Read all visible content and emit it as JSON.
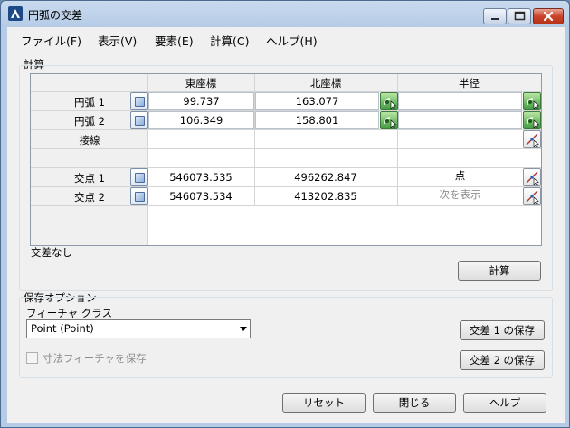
{
  "window": {
    "title": "円弧の交差"
  },
  "menu": [
    "ファイル(F)",
    "表示(V)",
    "要素(E)",
    "計算(C)",
    "ヘルプ(H)"
  ],
  "calc_group": {
    "label": "計算",
    "columns": [
      "東座標",
      "北座標",
      "半径"
    ],
    "rows": {
      "arc1": {
        "label": "円弧 1",
        "east": "99.737",
        "north": "163.077",
        "radius": ""
      },
      "arc2": {
        "label": "円弧 2",
        "east": "106.349",
        "north": "158.801",
        "radius": ""
      },
      "tangent": {
        "label": "接線"
      },
      "intersection1": {
        "label": "交点 1",
        "east": "546073.535",
        "north": "496262.847",
        "status": "点"
      },
      "intersection2": {
        "label": "交点 2",
        "east": "546073.534",
        "north": "413202.835",
        "status": "次を表示"
      }
    },
    "status_message": "交差なし",
    "calculate_button": "計算"
  },
  "save_options": {
    "label": "保存オプション",
    "feature_class_label": "フィーチャ クラス",
    "feature_class_value": "Point (Point)",
    "save_dimension_checkbox": "寸法フィーチャを保存",
    "save_dimension_checked": false,
    "save_intersection1_button": "交差 1 の保存",
    "save_intersection2_button": "交差 2 の保存"
  },
  "footer": {
    "reset": "リセット",
    "close": "閉じる",
    "help": "ヘルプ"
  },
  "icons": {
    "app": "autocad-a-icon",
    "select": "select-feature-icon",
    "arc": "arc-tool-icon",
    "pick": "pick-point-icon"
  }
}
